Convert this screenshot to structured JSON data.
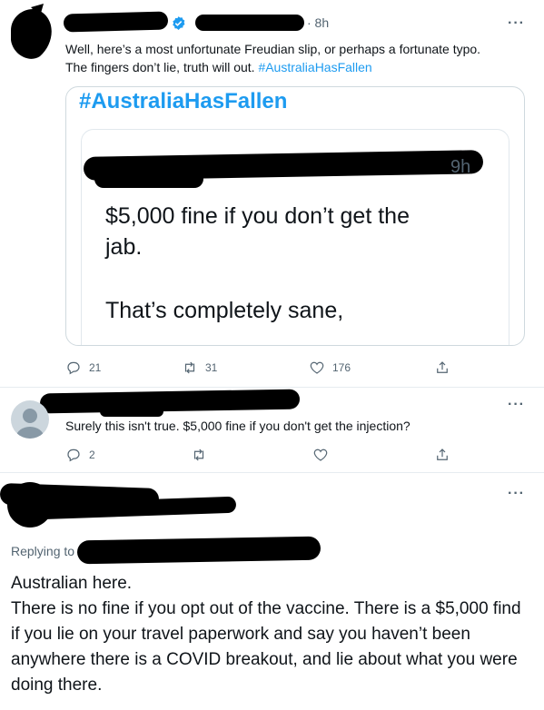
{
  "tweet1": {
    "time": "· 8h",
    "text_line1": "Well, here’s a most unfortunate Freudian slip, or perhaps a fortunate typo.",
    "text_line2_prefix": "The fingers don’t lie, truth will out. ",
    "hashtag": "#AustraliaHasFallen",
    "more_label": "···",
    "media": {
      "hashtag_heading": "#AustraliaHasFallen",
      "quoted_time": "9h",
      "quoted_line1": "$5,000 fine if you don’t get the",
      "quoted_line2": "jab.",
      "quoted_line3": "That’s completely sane,"
    },
    "actions": {
      "replies": "21",
      "retweets": "31",
      "likes": "176"
    }
  },
  "tweet2": {
    "text": "Surely this isn't true. $5,000 fine if you don't get the injection?",
    "more_label": "···",
    "actions": {
      "replies": "2"
    }
  },
  "tweet3": {
    "more_label": "···",
    "replying_to": "Replying to",
    "text": "Australian here.\nThere is no fine if you opt out of the vaccine. There is a $5,000 find  if you lie on your travel paperwork and say you haven’t been anywhere there is a COVID breakout, and lie about what you were doing there."
  },
  "colors": {
    "accent": "#1d9bf0",
    "muted": "#536471",
    "verified": "#1d9bf0"
  }
}
